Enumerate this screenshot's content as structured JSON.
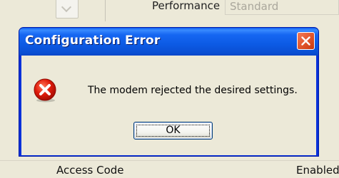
{
  "background_window": {
    "performance_label": "Performance",
    "performance_value": "Standard",
    "access_code_label": "Access Code",
    "enabled_label": "Enabled"
  },
  "dialog": {
    "title": "Configuration Error",
    "message": "The modem rejected the desired settings.",
    "ok_label": "OK",
    "icon": "error-icon",
    "close_icon": "close-icon"
  },
  "colors": {
    "titlebar": "#0a5ae4",
    "close_button": "#e45a32",
    "error_red": "#e01b0b",
    "window_bg": "#ece9d8"
  }
}
